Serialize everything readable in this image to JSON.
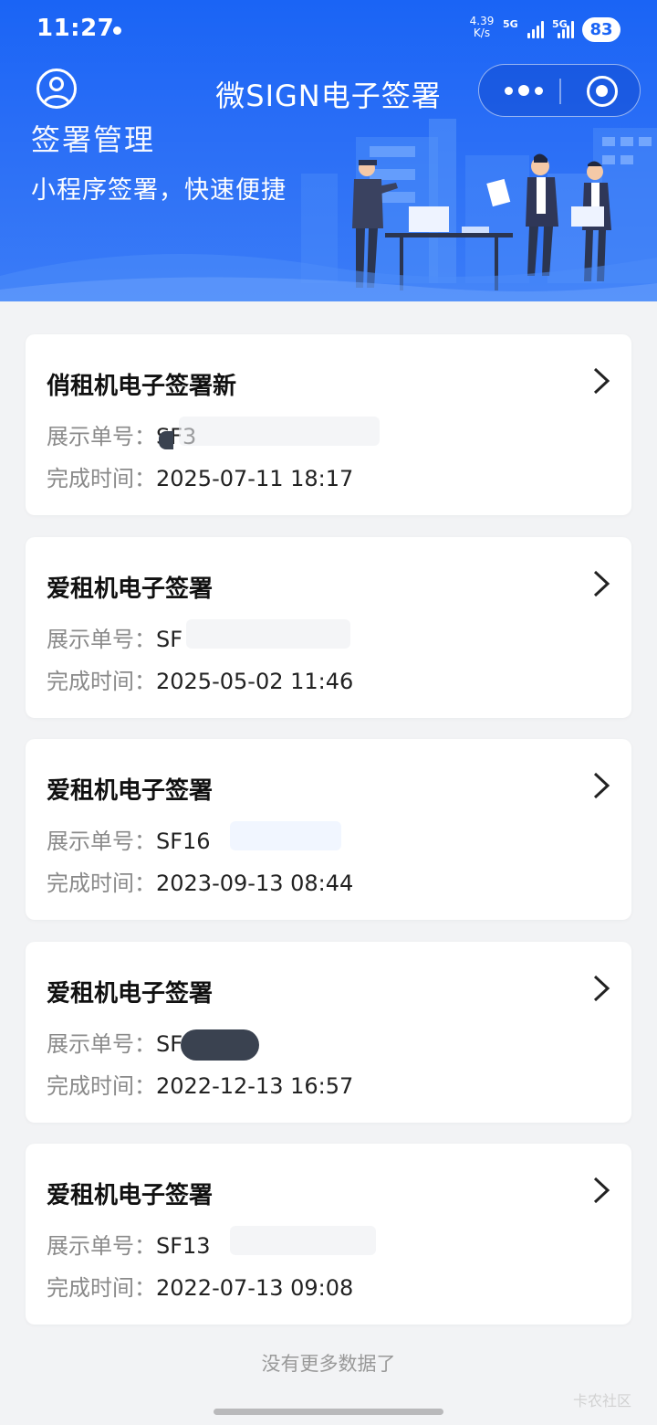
{
  "status_bar": {
    "time": "11:27",
    "net_speed_value": "4.39",
    "net_speed_unit": "K/s",
    "sim1_label": "5G",
    "sim2_label": "5G",
    "battery": "83"
  },
  "nav": {
    "title": "微SIGN电子签署",
    "more_icon": "more-dots-icon",
    "close_icon": "target-circle-icon",
    "avatar_icon": "user-icon"
  },
  "hero": {
    "heading": "签署管理",
    "subheading": "小程序签署，快速便捷"
  },
  "records": [
    {
      "title": "俏租机电子签署新",
      "order_label": "展示单号：",
      "order_value": "SF3",
      "time_label": "完成时间：",
      "time_value": "2025-07-11 18:17"
    },
    {
      "title": "爱租机电子签署",
      "order_label": "展示单号：",
      "order_value": "SF",
      "time_label": "完成时间：",
      "time_value": "2025-05-02 11:46"
    },
    {
      "title": "爱租机电子签署",
      "order_label": "展示单号：",
      "order_value": "SF16",
      "time_label": "完成时间：",
      "time_value": "2023-09-13 08:44"
    },
    {
      "title": "爱租机电子签署",
      "order_label": "展示单号：",
      "order_value": "SF13",
      "time_label": "完成时间：",
      "time_value": "2022-12-13 16:57"
    },
    {
      "title": "爱租机电子签署",
      "order_label": "展示单号：",
      "order_value": "SF13",
      "time_label": "完成时间：",
      "time_value": "2022-07-13 09:08"
    }
  ],
  "footer": {
    "no_more": "没有更多数据了",
    "watermark": "卡农社区"
  },
  "colors": {
    "brand_blue": "#1a64f5",
    "background": "#f2f3f5",
    "card": "#ffffff"
  }
}
